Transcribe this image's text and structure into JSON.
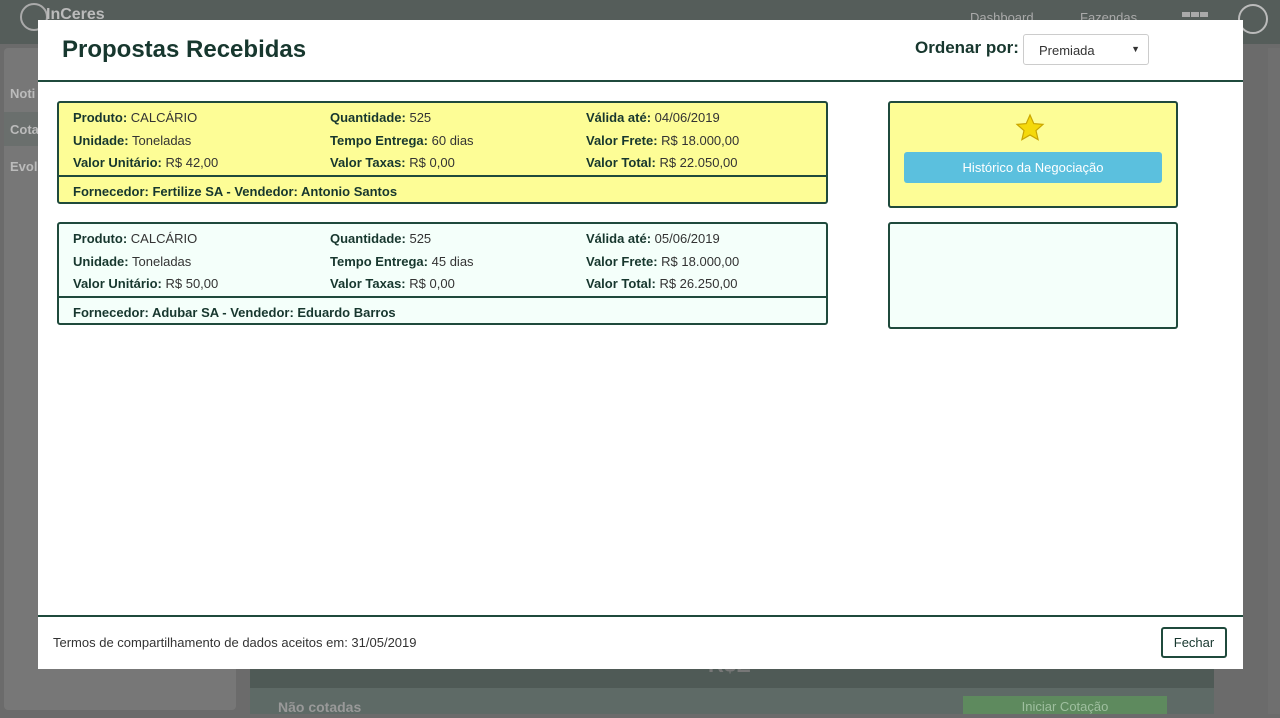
{
  "app": {
    "logo_text": "InCeres",
    "nav": [
      "Dashboard",
      "Fazendas"
    ],
    "sidebar_items": [
      "Noti",
      "Cota",
      "Evol"
    ],
    "bg_heading": "R$E",
    "bg_section_label": "Não cotadas",
    "bg_action_button": "Iniciar Cotação"
  },
  "modal": {
    "title": "Propostas Recebidas",
    "order_label": "Ordenar por:",
    "order_value": "Premiada",
    "footer_text": "Termos de compartilhamento de dados aceitos em: 31/05/2019",
    "close_label": "Fechar"
  },
  "labels": {
    "produto": "Produto:",
    "quantidade": "Quantidade:",
    "valida": "Válida até:",
    "unidade": "Unidade:",
    "tempo": "Tempo Entrega:",
    "frete": "Valor Frete:",
    "unitario": "Valor Unitário:",
    "taxas": "Valor Taxas:",
    "total": "Valor Total:"
  },
  "proposals": [
    {
      "produto": "CALCÁRIO",
      "quantidade": "525",
      "valida": "04/06/2019",
      "unidade": "Toneladas",
      "tempo": "60 dias",
      "frete": "R$ 18.000,00",
      "unitario": "R$ 42,00",
      "taxas": "R$ 0,00",
      "total": "R$ 22.050,00",
      "fornecedor": "Fornecedor: Fertilize SA - Vendedor: Antonio Santos",
      "history_label": "Histórico da Negociação",
      "star_icon": "star-icon"
    },
    {
      "produto": "CALCÁRIO",
      "quantidade": "525",
      "valida": "05/06/2019",
      "unidade": "Toneladas",
      "tempo": "45 dias",
      "frete": "R$ 18.000,00",
      "unitario": "R$ 50,00",
      "taxas": "R$ 0,00",
      "total": "R$ 26.250,00",
      "fornecedor": "Fornecedor: Adubar SA - Vendedor: Eduardo Barros"
    }
  ],
  "colors": {
    "premiada_bg": "#fdfd96",
    "normal_bg": "#f4fffa",
    "border": "#1f4a3c",
    "info_button": "#5bc0de"
  }
}
